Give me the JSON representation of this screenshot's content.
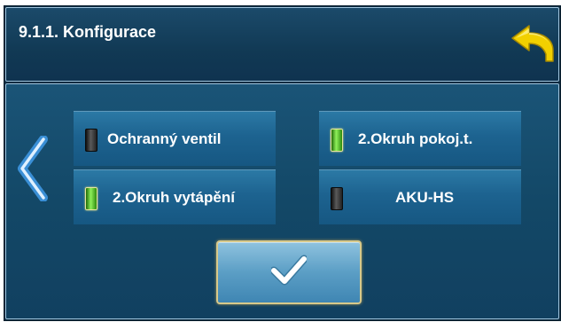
{
  "header": {
    "title": "9.1.1. Konfigurace"
  },
  "icons": {
    "back": "back-arrow-icon",
    "nav_left": "chevron-left-icon",
    "confirm": "checkmark-icon",
    "led_on": "led-on-icon",
    "led_off": "led-off-icon"
  },
  "options": [
    {
      "label": "Ochranný ventil",
      "active": false
    },
    {
      "label": "2.Okruh pokoj.t.",
      "active": true
    },
    {
      "label": "2.Okruh vytápění",
      "active": true
    },
    {
      "label": "AKU-HS",
      "active": false
    }
  ],
  "colors": {
    "panel_bg": "#134867",
    "button": "#1d6390",
    "led_on": "#8ff05a",
    "led_off": "#3a3a3a",
    "back_arrow": "#f2d000"
  }
}
